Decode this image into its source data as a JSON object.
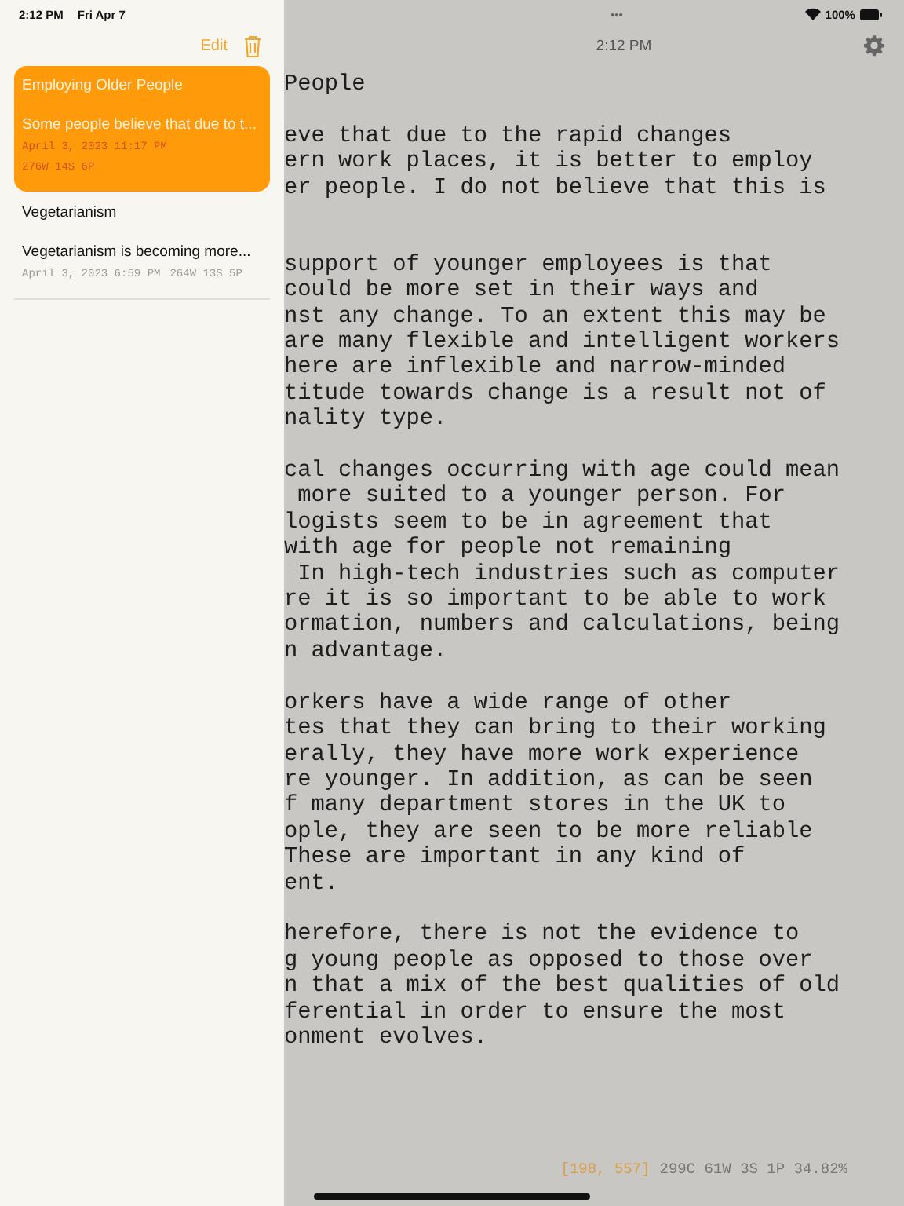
{
  "status_bar": {
    "time": "2:12 PM",
    "date": "Fri Apr 7",
    "dots": "•••",
    "battery": "100%"
  },
  "sidebar": {
    "edit": "Edit",
    "notes": [
      {
        "title": "Employing Older People",
        "preview": "Some people believe that due to t...",
        "date": "April 3, 2023 11:17 PM",
        "stats": "276W 14S 6P",
        "selected": true
      },
      {
        "title": "Vegetarianism",
        "preview": "Vegetarianism is becoming more...",
        "date": "April 3, 2023 6:59 PM",
        "stats": "264W 13S 5P",
        "selected": false
      }
    ]
  },
  "editor": {
    "time": "2:12 PM",
    "title": "People",
    "paragraphs": [
      [
        "eve that due to the rapid changes",
        "ern work places, it is better to employ",
        "er people. I do not believe that this is"
      ],
      [
        "support of younger employees is that",
        "could be more set in their ways and",
        "nst any change. To an extent this may be",
        "are many flexible and intelligent workers",
        "here are inflexible and narrow-minded",
        "titude towards change is a result not of",
        "nality type."
      ],
      [
        "cal changes occurring with age could mean",
        " more suited to a younger person. For",
        "logists seem to be in agreement that",
        "with age for people not remaining",
        " In high-tech industries such as computer",
        "re it is so important to be able to work",
        "ormation, numbers and calculations, being",
        "n advantage."
      ],
      [
        "orkers have a wide range of other",
        "tes that they can bring to their working",
        "erally, they have more work experience",
        "re younger. In addition, as can be seen",
        "f many department stores in the UK to",
        "ople, they are seen to be more reliable",
        "These are important in any kind of",
        "ent."
      ],
      [
        "herefore, there is not the evidence to",
        "g young people as opposed to those over",
        "n that a mix of the best qualities of old",
        "ferential in order to ensure the most",
        "onment evolves."
      ]
    ],
    "cursor": "[198, 557]",
    "counts": "299C 61W 3S 1P 34.82%"
  }
}
